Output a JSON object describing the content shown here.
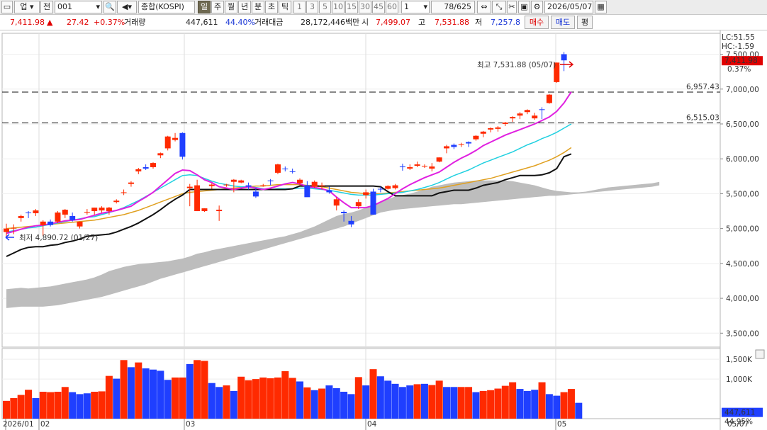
{
  "toolbar": {
    "market": "업",
    "prev": "전",
    "code": "001",
    "name": "종합(KOSPI)",
    "periods": [
      "일",
      "주",
      "월",
      "년",
      "분",
      "초",
      "틱"
    ],
    "active_period": "일",
    "minutes": [
      "1",
      "3",
      "5",
      "10",
      "15",
      "30",
      "45",
      "60"
    ],
    "unit_value": "1",
    "count": "78/625",
    "date": "2026/05/07"
  },
  "quote": {
    "price": "7,411.98",
    "change": "27.42",
    "change_pct": "+0.37%",
    "volume_label": "거래량",
    "volume": "447,611",
    "volume_ratio": "44.40%",
    "amount_label": "거래대금",
    "amount": "28,172,446백만",
    "open_label": "시",
    "open": "7,499.07",
    "high_label": "고",
    "high": "7,531.88",
    "low_label": "저",
    "low": "7,257.8",
    "buy": "매수",
    "sell": "매도",
    "eval": "평"
  },
  "chart_data": {
    "type": "candlestick",
    "price_axis_ticks": [
      "7,500,00",
      "7,000,00",
      "6,500,00",
      "6,000,00",
      "5,500,00",
      "5,000,00",
      "4,500,00",
      "4,000,00",
      "3,500,00"
    ],
    "price_range": [
      3300,
      7800
    ],
    "volume_axis_ticks": [
      "1,500K",
      "1,000K"
    ],
    "x_tick_labels": [
      "2026/01",
      "02",
      "03",
      "04",
      "05"
    ],
    "right_date_label": "05/07",
    "lc_label": "LC:51.55",
    "hc_label": "HC:-1.59",
    "last_price_tag": "7,411.98",
    "last_pct_tag": "0.37%",
    "last_volume_tag": "447,611",
    "volume_pct_tag": "44.95%",
    "high_annotation": "최고 7,531.88 (05/07)",
    "low_annotation": "최저 4,890.72 (01/27)",
    "hlines": [
      {
        "value": 6957.43,
        "label": "6,957.43"
      },
      {
        "value": 6515.03,
        "label": "6,515.03"
      }
    ],
    "candles": [
      [
        4950,
        5070,
        4880,
        5000
      ],
      [
        5000,
        5060,
        4920,
        5010
      ],
      [
        5150,
        5200,
        5100,
        5180
      ],
      [
        5230,
        5250,
        5150,
        5220
      ],
      [
        5220,
        5280,
        5180,
        5260
      ],
      [
        5050,
        5120,
        4890,
        5100
      ],
      [
        5100,
        5130,
        5030,
        5050
      ],
      [
        5100,
        5250,
        5080,
        5230
      ],
      [
        5200,
        5280,
        5150,
        5270
      ],
      [
        5180,
        5230,
        5100,
        5120
      ],
      [
        5030,
        5100,
        5000,
        5100
      ],
      [
        5240,
        5280,
        5200,
        5240
      ],
      [
        5250,
        5300,
        5200,
        5300
      ],
      [
        5260,
        5320,
        5230,
        5300
      ],
      [
        5250,
        5310,
        5200,
        5300
      ],
      [
        5380,
        5420,
        5360,
        5400
      ],
      [
        5520,
        5560,
        5480,
        5520
      ],
      [
        5640,
        5680,
        5600,
        5660
      ],
      [
        5820,
        5870,
        5780,
        5850
      ],
      [
        5880,
        5920,
        5840,
        5860
      ],
      [
        5880,
        5950,
        5860,
        5940
      ],
      [
        6050,
        6090,
        6010,
        6080
      ],
      [
        6150,
        6330,
        6120,
        6320
      ],
      [
        6270,
        6370,
        6250,
        6300
      ],
      [
        6370,
        6380,
        5990,
        6030
      ],
      [
        5580,
        5640,
        5320,
        5600
      ],
      [
        5250,
        5700,
        5250,
        5620
      ],
      [
        5250,
        5290,
        5240,
        5290
      ],
      [
        5610,
        5650,
        5570,
        5630
      ],
      [
        5250,
        5330,
        5110,
        5270
      ],
      [
        5620,
        5640,
        5600,
        5630
      ],
      [
        5670,
        5710,
        5520,
        5700
      ],
      [
        5660,
        5700,
        5650,
        5690
      ],
      [
        5620,
        5660,
        5560,
        5600
      ],
      [
        5530,
        5580,
        5440,
        5460
      ],
      [
        5620,
        5640,
        5600,
        5620
      ],
      [
        5690,
        5710,
        5620,
        5680
      ],
      [
        5800,
        5930,
        5780,
        5920
      ],
      [
        5860,
        5890,
        5820,
        5850
      ],
      [
        5820,
        5860,
        5790,
        5810
      ],
      [
        5650,
        5720,
        5620,
        5700
      ],
      [
        5620,
        5680,
        5460,
        5450
      ],
      [
        5600,
        5690,
        5580,
        5670
      ],
      [
        5610,
        5660,
        5560,
        5620
      ],
      [
        5550,
        5600,
        5500,
        5520
      ],
      [
        5330,
        5450,
        5260,
        5420
      ],
      [
        5240,
        5260,
        5100,
        5220
      ],
      [
        5110,
        5180,
        5020,
        5060
      ],
      [
        5320,
        5420,
        5280,
        5380
      ],
      [
        5480,
        5560,
        5430,
        5520
      ],
      [
        5530,
        5570,
        5200,
        5200
      ],
      [
        5570,
        5600,
        5520,
        5560
      ],
      [
        5570,
        5620,
        5560,
        5610
      ],
      [
        5580,
        5640,
        5560,
        5620
      ],
      [
        5890,
        5930,
        5830,
        5880
      ],
      [
        5860,
        5920,
        5840,
        5880
      ],
      [
        5900,
        5960,
        5880,
        5920
      ],
      [
        5890,
        5920,
        5870,
        5900
      ],
      [
        5860,
        5940,
        5820,
        5890
      ],
      [
        5960,
        6020,
        5950,
        6020
      ],
      [
        6150,
        6200,
        6080,
        6180
      ],
      [
        6200,
        6220,
        6140,
        6170
      ],
      [
        6200,
        6230,
        6170,
        6210
      ],
      [
        6240,
        6250,
        6170,
        6220
      ],
      [
        6280,
        6340,
        6260,
        6330
      ],
      [
        6360,
        6400,
        6310,
        6390
      ],
      [
        6420,
        6450,
        6380,
        6440
      ],
      [
        6430,
        6470,
        6390,
        6450
      ],
      [
        6500,
        6530,
        6470,
        6520
      ],
      [
        6580,
        6610,
        6530,
        6600
      ],
      [
        6620,
        6670,
        6570,
        6650
      ],
      [
        6670,
        6710,
        6640,
        6700
      ],
      [
        6580,
        6660,
        6560,
        6620
      ],
      [
        6710,
        6740,
        6570,
        6700
      ],
      [
        6800,
        6930,
        6790,
        6920
      ],
      [
        7100,
        7380,
        7090,
        7380
      ],
      [
        7500,
        7532,
        7258,
        7412
      ]
    ],
    "volumes": [
      {
        "v": 0.45,
        "up": true
      },
      {
        "v": 0.52,
        "up": true
      },
      {
        "v": 0.6,
        "up": true
      },
      {
        "v": 0.73,
        "up": true
      },
      {
        "v": 0.52,
        "up": false
      },
      {
        "v": 0.68,
        "up": true
      },
      {
        "v": 0.67,
        "up": true
      },
      {
        "v": 0.68,
        "up": true
      },
      {
        "v": 0.8,
        "up": true
      },
      {
        "v": 0.67,
        "up": false
      },
      {
        "v": 0.62,
        "up": false
      },
      {
        "v": 0.64,
        "up": false
      },
      {
        "v": 0.68,
        "up": true
      },
      {
        "v": 0.69,
        "up": true
      },
      {
        "v": 1.08,
        "up": true
      },
      {
        "v": 1.01,
        "up": false
      },
      {
        "v": 1.48,
        "up": true
      },
      {
        "v": 1.3,
        "up": false
      },
      {
        "v": 1.42,
        "up": true
      },
      {
        "v": 1.27,
        "up": false
      },
      {
        "v": 1.24,
        "up": false
      },
      {
        "v": 1.21,
        "up": false
      },
      {
        "v": 0.98,
        "up": false
      },
      {
        "v": 1.04,
        "up": true
      },
      {
        "v": 1.04,
        "up": true
      },
      {
        "v": 1.38,
        "up": false
      },
      {
        "v": 1.48,
        "up": true
      },
      {
        "v": 1.46,
        "up": true
      },
      {
        "v": 0.9,
        "up": false
      },
      {
        "v": 0.8,
        "up": false
      },
      {
        "v": 0.84,
        "up": true
      },
      {
        "v": 0.7,
        "up": false
      },
      {
        "v": 1.06,
        "up": true
      },
      {
        "v": 0.97,
        "up": true
      },
      {
        "v": 1.0,
        "up": true
      },
      {
        "v": 1.04,
        "up": true
      },
      {
        "v": 1.02,
        "up": true
      },
      {
        "v": 1.04,
        "up": true
      },
      {
        "v": 1.2,
        "up": true
      },
      {
        "v": 1.03,
        "up": true
      },
      {
        "v": 0.94,
        "up": false
      },
      {
        "v": 0.79,
        "up": true
      },
      {
        "v": 0.72,
        "up": false
      },
      {
        "v": 0.76,
        "up": true
      },
      {
        "v": 0.84,
        "up": false
      },
      {
        "v": 0.77,
        "up": false
      },
      {
        "v": 0.68,
        "up": false
      },
      {
        "v": 0.62,
        "up": false
      },
      {
        "v": 1.05,
        "up": true
      },
      {
        "v": 0.84,
        "up": false
      },
      {
        "v": 1.25,
        "up": true
      },
      {
        "v": 1.07,
        "up": false
      },
      {
        "v": 0.96,
        "up": false
      },
      {
        "v": 0.88,
        "up": false
      },
      {
        "v": 0.8,
        "up": false
      },
      {
        "v": 0.84,
        "up": false
      },
      {
        "v": 0.87,
        "up": true
      },
      {
        "v": 0.88,
        "up": false
      },
      {
        "v": 0.85,
        "up": true
      },
      {
        "v": 0.96,
        "up": true
      },
      {
        "v": 0.8,
        "up": false
      },
      {
        "v": 0.8,
        "up": false
      },
      {
        "v": 0.8,
        "up": true
      },
      {
        "v": 0.8,
        "up": true
      },
      {
        "v": 0.67,
        "up": false
      },
      {
        "v": 0.7,
        "up": true
      },
      {
        "v": 0.72,
        "up": true
      },
      {
        "v": 0.76,
        "up": true
      },
      {
        "v": 0.83,
        "up": true
      },
      {
        "v": 0.92,
        "up": true
      },
      {
        "v": 0.75,
        "up": false
      },
      {
        "v": 0.7,
        "up": false
      },
      {
        "v": 0.73,
        "up": false
      },
      {
        "v": 0.92,
        "up": true
      },
      {
        "v": 0.62,
        "up": false
      },
      {
        "v": 0.58,
        "up": false
      },
      {
        "v": 0.67,
        "up": true
      },
      {
        "v": 0.75,
        "up": true
      },
      {
        "v": 0.4,
        "up": false
      }
    ],
    "ma_magenta": [
      4930,
      4960,
      4990,
      5020,
      5040,
      5050,
      5070,
      5090,
      5110,
      5120,
      5130,
      5160,
      5190,
      5220,
      5240,
      5260,
      5290,
      5320,
      5390,
      5450,
      5520,
      5610,
      5700,
      5790,
      5840,
      5830,
      5770,
      5700,
      5660,
      5600,
      5580,
      5560,
      5580,
      5600,
      5580,
      5560,
      5580,
      5610,
      5640,
      5660,
      5640,
      5600,
      5590,
      5570,
      5540,
      5450,
      5370,
      5300,
      5300,
      5300,
      5330,
      5380,
      5430,
      5500,
      5570,
      5630,
      5680,
      5730,
      5770,
      5810,
      5880,
      5950,
      6010,
      6060,
      6120,
      6190,
      6240,
      6290,
      6340,
      6380,
      6420,
      6460,
      6500,
      6550,
      6600,
      6680,
      6800,
      6960
    ],
    "ma_cyan": [
      4950,
      4970,
      4990,
      5010,
      5020,
      5040,
      5060,
      5080,
      5100,
      5120,
      5140,
      5160,
      5170,
      5200,
      5230,
      5260,
      5300,
      5350,
      5400,
      5460,
      5520,
      5580,
      5640,
      5700,
      5760,
      5770,
      5760,
      5720,
      5680,
      5650,
      5630,
      5610,
      5600,
      5600,
      5590,
      5570,
      5560,
      5570,
      5570,
      5570,
      5580,
      5580,
      5570,
      5560,
      5550,
      5530,
      5510,
      5490,
      5480,
      5480,
      5480,
      5490,
      5500,
      5510,
      5520,
      5540,
      5560,
      5590,
      5620,
      5660,
      5710,
      5760,
      5800,
      5840,
      5890,
      5940,
      5980,
      6020,
      6060,
      6100,
      6150,
      6200,
      6240,
      6290,
      6330,
      6380,
      6440,
      6500
    ],
    "ma_orange": [
      5000,
      5010,
      5020,
      5030,
      5040,
      5050,
      5060,
      5070,
      5080,
      5090,
      5100,
      5110,
      5120,
      5140,
      5160,
      5180,
      5200,
      5230,
      5260,
      5300,
      5340,
      5380,
      5420,
      5460,
      5500,
      5520,
      5530,
      5540,
      5550,
      5560,
      5570,
      5580,
      5590,
      5600,
      5610,
      5610,
      5620,
      5630,
      5630,
      5630,
      5630,
      5620,
      5610,
      5600,
      5580,
      5560,
      5540,
      5520,
      5510,
      5500,
      5500,
      5500,
      5510,
      5520,
      5530,
      5540,
      5550,
      5560,
      5570,
      5580,
      5600,
      5620,
      5640,
      5660,
      5680,
      5700,
      5720,
      5750,
      5780,
      5810,
      5840,
      5870,
      5900,
      5940,
      5980,
      6030,
      6090,
      6160
    ],
    "kijun_black": [
      4600,
      4650,
      4700,
      4730,
      4740,
      4740,
      4760,
      4770,
      4800,
      4820,
      4850,
      4890,
      4900,
      4910,
      4920,
      4950,
      4990,
      5030,
      5080,
      5140,
      5200,
      5270,
      5350,
      5420,
      5480,
      5560,
      5560,
      5560,
      5560,
      5560,
      5560,
      5560,
      5560,
      5560,
      5560,
      5560,
      5560,
      5560,
      5560,
      5570,
      5610,
      5610,
      5610,
      5610,
      5610,
      5610,
      5610,
      5610,
      5610,
      5610,
      5610,
      5600,
      5530,
      5470,
      5470,
      5470,
      5470,
      5470,
      5470,
      5510,
      5530,
      5550,
      5550,
      5550,
      5580,
      5620,
      5640,
      5660,
      5700,
      5730,
      5760,
      5760,
      5760,
      5770,
      5800,
      5860,
      6030,
      6070
    ],
    "cloud_upper": [
      4130,
      4140,
      4150,
      4140,
      4150,
      4160,
      4170,
      4190,
      4210,
      4230,
      4250,
      4270,
      4300,
      4340,
      4390,
      4420,
      4450,
      4470,
      4490,
      4500,
      4510,
      4520,
      4530,
      4550,
      4570,
      4600,
      4640,
      4660,
      4690,
      4710,
      4730,
      4750,
      4770,
      4790,
      4810,
      4830,
      4850,
      4870,
      4890,
      4920,
      4950,
      4990,
      5030,
      5080,
      5130,
      5180,
      5210,
      5230,
      5260,
      5300,
      5340,
      5380,
      5420,
      5460,
      5480,
      5500,
      5530,
      5560,
      5600,
      5620,
      5640,
      5660,
      5670,
      5680,
      5690,
      5690,
      5690,
      5690,
      5690,
      5680,
      5660,
      5640,
      5620,
      5590,
      5560,
      5540,
      5530,
      5520,
      5520,
      5530,
      5550,
      5570,
      5590,
      5600,
      5610,
      5620,
      5630,
      5640,
      5650,
      5670
    ],
    "cloud_lower": [
      3860,
      3870,
      3880,
      3880,
      3880,
      3880,
      3890,
      3900,
      3920,
      3940,
      3960,
      3980,
      4000,
      4020,
      4050,
      4080,
      4110,
      4140,
      4170,
      4200,
      4240,
      4280,
      4310,
      4340,
      4370,
      4400,
      4430,
      4460,
      4490,
      4520,
      4550,
      4580,
      4610,
      4640,
      4670,
      4700,
      4730,
      4760,
      4790,
      4820,
      4850,
      4880,
      4910,
      4940,
      4970,
      5000,
      5030,
      5070,
      5110,
      5150,
      5190,
      5230,
      5250,
      5270,
      5280,
      5290,
      5300,
      5310,
      5320,
      5330,
      5340,
      5350,
      5350,
      5360,
      5370,
      5380,
      5390,
      5400,
      5410,
      5420,
      5430,
      5440,
      5450,
      5460,
      5470,
      5470,
      5480,
      5490,
      5500,
      5510,
      5520,
      5530,
      5540,
      5550,
      5560,
      5570,
      5580,
      5590,
      5600,
      5620
    ]
  },
  "colors": {
    "up": "#ff2a00",
    "down": "#1f3fff",
    "ma_fast": "#e020e0",
    "ma_mid": "#20d0e0",
    "ma_slow": "#e0a020",
    "kijun": "#111111",
    "cloud": "#bdbdbd"
  }
}
